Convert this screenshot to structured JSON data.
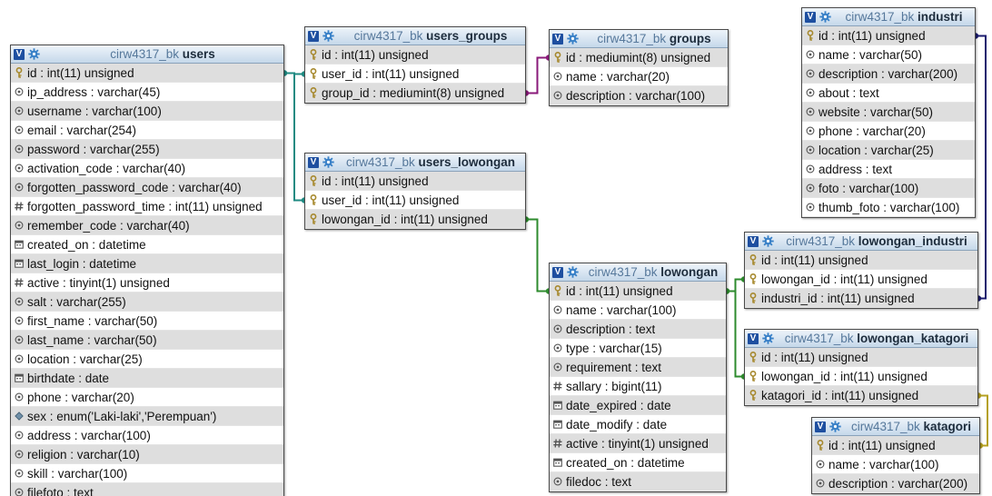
{
  "tables": [
    {
      "id": "users",
      "db": "cirw4317_bk",
      "name": "users",
      "columns": [
        {
          "text": "id : int(11) unsigned",
          "icon": "key"
        },
        {
          "text": "ip_address : varchar(45)",
          "icon": "text"
        },
        {
          "text": "username : varchar(100)",
          "icon": "text"
        },
        {
          "text": "email : varchar(254)",
          "icon": "text"
        },
        {
          "text": "password : varchar(255)",
          "icon": "text"
        },
        {
          "text": "activation_code : varchar(40)",
          "icon": "text"
        },
        {
          "text": "forgotten_password_code : varchar(40)",
          "icon": "text"
        },
        {
          "text": "forgotten_password_time : int(11) unsigned",
          "icon": "number"
        },
        {
          "text": "remember_code : varchar(40)",
          "icon": "text"
        },
        {
          "text": "created_on : datetime",
          "icon": "date"
        },
        {
          "text": "last_login : datetime",
          "icon": "date"
        },
        {
          "text": "active : tinyint(1) unsigned",
          "icon": "number"
        },
        {
          "text": "salt : varchar(255)",
          "icon": "text"
        },
        {
          "text": "first_name : varchar(50)",
          "icon": "text"
        },
        {
          "text": "last_name : varchar(50)",
          "icon": "text"
        },
        {
          "text": "location : varchar(25)",
          "icon": "text"
        },
        {
          "text": "birthdate : date",
          "icon": "date"
        },
        {
          "text": "phone : varchar(20)",
          "icon": "text"
        },
        {
          "text": "sex : enum('Laki-laki','Perempuan')",
          "icon": "enum"
        },
        {
          "text": "address : varchar(100)",
          "icon": "text"
        },
        {
          "text": "religion : varchar(10)",
          "icon": "text"
        },
        {
          "text": "skill : varchar(100)",
          "icon": "text"
        },
        {
          "text": "filefoto : text",
          "icon": "text"
        }
      ]
    },
    {
      "id": "users_groups",
      "db": "cirw4317_bk",
      "name": "users_groups",
      "columns": [
        {
          "text": "id : int(11) unsigned",
          "icon": "key"
        },
        {
          "text": "user_id : int(11) unsigned",
          "icon": "key"
        },
        {
          "text": "group_id : mediumint(8) unsigned",
          "icon": "key"
        }
      ]
    },
    {
      "id": "groups",
      "db": "cirw4317_bk",
      "name": "groups",
      "columns": [
        {
          "text": "id : mediumint(8) unsigned",
          "icon": "key"
        },
        {
          "text": "name : varchar(20)",
          "icon": "text"
        },
        {
          "text": "description : varchar(100)",
          "icon": "text"
        }
      ]
    },
    {
      "id": "users_lowongan",
      "db": "cirw4317_bk",
      "name": "users_lowongan",
      "columns": [
        {
          "text": "id : int(11) unsigned",
          "icon": "key"
        },
        {
          "text": "user_id : int(11) unsigned",
          "icon": "key"
        },
        {
          "text": "lowongan_id : int(11) unsigned",
          "icon": "key"
        }
      ]
    },
    {
      "id": "industri",
      "db": "cirw4317_bk",
      "name": "industri",
      "columns": [
        {
          "text": "id : int(11) unsigned",
          "icon": "key"
        },
        {
          "text": "name : varchar(50)",
          "icon": "text"
        },
        {
          "text": "description : varchar(200)",
          "icon": "text"
        },
        {
          "text": "about : text",
          "icon": "text"
        },
        {
          "text": "website : varchar(50)",
          "icon": "text"
        },
        {
          "text": "phone : varchar(20)",
          "icon": "text"
        },
        {
          "text": "location : varchar(25)",
          "icon": "text"
        },
        {
          "text": "address : text",
          "icon": "text"
        },
        {
          "text": "foto : varchar(100)",
          "icon": "text"
        },
        {
          "text": "thumb_foto : varchar(100)",
          "icon": "text"
        }
      ]
    },
    {
      "id": "lowongan_industri",
      "db": "cirw4317_bk",
      "name": "lowongan_industri",
      "columns": [
        {
          "text": "id : int(11) unsigned",
          "icon": "key"
        },
        {
          "text": "lowongan_id : int(11) unsigned",
          "icon": "key"
        },
        {
          "text": "industri_id : int(11) unsigned",
          "icon": "key"
        }
      ]
    },
    {
      "id": "lowongan",
      "db": "cirw4317_bk",
      "name": "lowongan",
      "columns": [
        {
          "text": "id : int(11) unsigned",
          "icon": "key"
        },
        {
          "text": "name : varchar(100)",
          "icon": "text"
        },
        {
          "text": "description : text",
          "icon": "text"
        },
        {
          "text": "type : varchar(15)",
          "icon": "text"
        },
        {
          "text": "requirement : text",
          "icon": "text"
        },
        {
          "text": "sallary : bigint(11)",
          "icon": "number"
        },
        {
          "text": "date_expired : date",
          "icon": "date"
        },
        {
          "text": "date_modify : date",
          "icon": "date"
        },
        {
          "text": "active : tinyint(1) unsigned",
          "icon": "number"
        },
        {
          "text": "created_on : datetime",
          "icon": "date"
        },
        {
          "text": "filedoc : text",
          "icon": "text"
        }
      ]
    },
    {
      "id": "lowongan_katagori",
      "db": "cirw4317_bk",
      "name": "lowongan_katagori",
      "columns": [
        {
          "text": "id : int(11) unsigned",
          "icon": "key"
        },
        {
          "text": "lowongan_id : int(11) unsigned",
          "icon": "key"
        },
        {
          "text": "katagori_id : int(11) unsigned",
          "icon": "key"
        }
      ]
    },
    {
      "id": "katagori",
      "db": "cirw4317_bk",
      "name": "katagori",
      "columns": [
        {
          "text": "id : int(11) unsigned",
          "icon": "key"
        },
        {
          "text": "name : varchar(100)",
          "icon": "text"
        },
        {
          "text": "description : varchar(200)",
          "icon": "text"
        }
      ]
    }
  ],
  "relations": [
    {
      "from": "users_groups",
      "from_col": 1,
      "to": "users",
      "to_col": 0,
      "color": "#1f8a82"
    },
    {
      "from": "users_lowongan",
      "from_col": 1,
      "to": "users",
      "to_col": 0,
      "color": "#1f8a82"
    },
    {
      "from": "users_groups",
      "from_col": 2,
      "to": "groups",
      "to_col": 0,
      "color": "#8a1a7a"
    },
    {
      "from": "users_lowongan",
      "from_col": 2,
      "to": "lowongan",
      "to_col": 0,
      "color": "#2e8b2e"
    },
    {
      "from": "lowongan_industri",
      "from_col": 1,
      "to": "lowongan",
      "to_col": 0,
      "color": "#2e8b2e"
    },
    {
      "from": "lowongan_katagori",
      "from_col": 1,
      "to": "lowongan",
      "to_col": 0,
      "color": "#2e8b2e"
    },
    {
      "from": "lowongan_industri",
      "from_col": 2,
      "to": "industri",
      "to_col": 0,
      "color": "#1a1a6e"
    },
    {
      "from": "lowongan_katagori",
      "from_col": 2,
      "to": "katagori",
      "to_col": 0,
      "color": "#b5a020"
    }
  ],
  "colors": {
    "header_gradient_top": "#eef4fa",
    "header_gradient_bottom": "#c5d8ea",
    "row_alt": "#dedede",
    "key_icon": "#a6882c"
  }
}
